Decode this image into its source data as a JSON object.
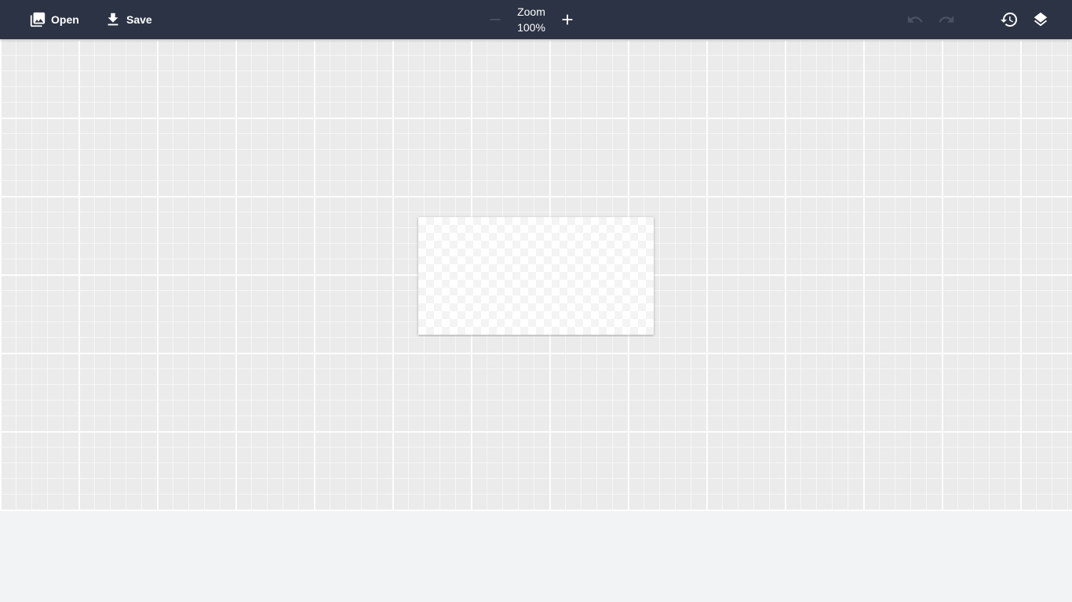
{
  "toolbar": {
    "open_label": "Open",
    "save_label": "Save",
    "zoom_label": "Zoom",
    "zoom_value": "100%"
  },
  "icons": {
    "open": "image-library-icon",
    "save": "download-icon",
    "zoom_out": "minus-icon",
    "zoom_in": "plus-icon",
    "undo": "undo-icon",
    "redo": "redo-icon",
    "history": "history-icon",
    "layers": "layers-icon"
  },
  "colors": {
    "toolbar_bg": "#2c3344",
    "toolbar_text": "#ffffff",
    "disabled_icon": "#4a5264",
    "workspace_bg": "#ebebeb",
    "page_bg": "#f2f3f5"
  }
}
